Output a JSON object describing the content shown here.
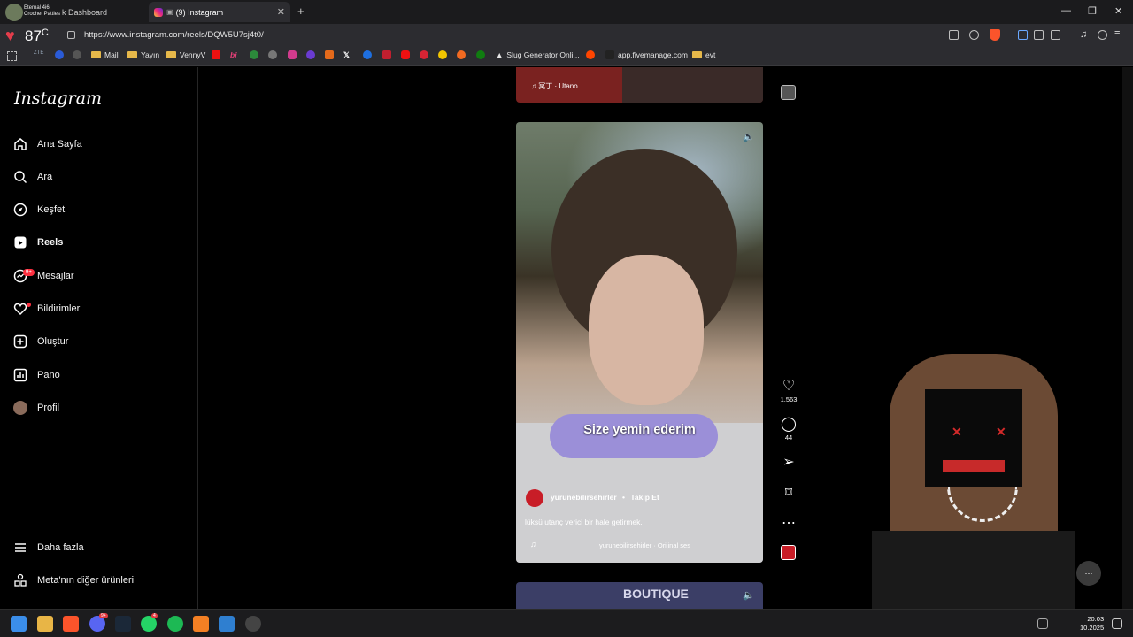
{
  "browser": {
    "tabs": [
      {
        "title": "k Dashboard",
        "active": false
      },
      {
        "title": "(9) Instagram",
        "active": true
      }
    ],
    "profile_chip": {
      "line1": "Eternal 4i6",
      "line2": "Crochet Patties"
    },
    "heart_value": "87",
    "url": "https://www.instagram.com/reels/DQW5U7sj4t0/",
    "bookmarks": [
      "ZTE",
      "Mail",
      "Yayın",
      "VennyV",
      "bi",
      "Slug Generator Onli...",
      "app.fivemanage.com",
      "evt"
    ]
  },
  "instagram": {
    "logo": "Instagram",
    "nav": [
      {
        "label": "Ana Sayfa",
        "icon": "home-icon"
      },
      {
        "label": "Ara",
        "icon": "search-icon"
      },
      {
        "label": "Keşfet",
        "icon": "compass-icon"
      },
      {
        "label": "Reels",
        "icon": "reels-icon"
      },
      {
        "label": "Mesajlar",
        "icon": "messenger-icon",
        "badge": "9+"
      },
      {
        "label": "Bildirimler",
        "icon": "heart-icon"
      },
      {
        "label": "Oluştur",
        "icon": "plus-square-icon"
      },
      {
        "label": "Pano",
        "icon": "dashboard-icon"
      },
      {
        "label": "Profil",
        "icon": "avatar"
      }
    ],
    "more": "Daha fazla",
    "meta": "Meta'nın diğer ürünleri"
  },
  "reels": {
    "prev_audio": "♫ 冥丁 · Utano",
    "current": {
      "caption": "Size yemin ederim",
      "username": "yurunebilirsehirler",
      "follow": "Takip Et",
      "description": "lüksü utanç verici bir hale getirmek.",
      "audio": "yurunebilirsehirler · Orijinal ses",
      "likes": "1.563",
      "comments": "44"
    },
    "next_text": "BOUTIQUE"
  },
  "taskbar": {
    "time": "20:03",
    "date": "10.2025",
    "badges": [
      "9+",
      "4"
    ]
  },
  "colors": {
    "accent_red": "#ff3040",
    "brave": "#fb542b"
  }
}
